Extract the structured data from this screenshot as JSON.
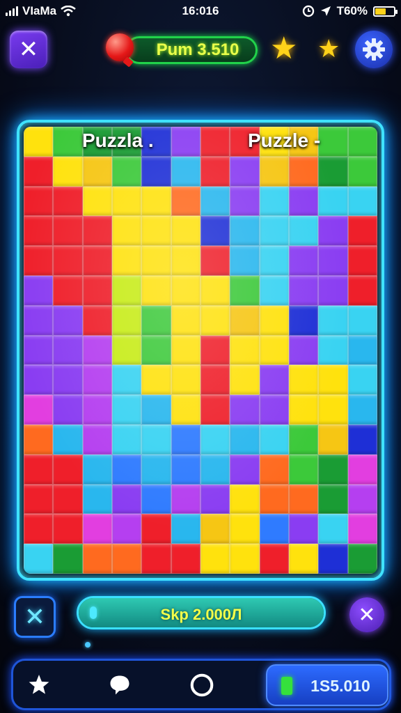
{
  "status_bar": {
    "carrier": "VIaMa",
    "time": "16:016",
    "battery_text": "T60%",
    "battery_level": 0.6
  },
  "header": {
    "score_label": "Pum 3.510",
    "stars_count": 2
  },
  "board": {
    "labels": [
      "Puzzla .",
      "Puzzle -"
    ],
    "columns": 12,
    "rows": 15,
    "palette": {
      "Y": "#ffe20d",
      "y": "#f6c614",
      "L": "#c7ec16",
      "G": "#3cc93a",
      "g": "#1a9c34",
      "C": "#39d3f2",
      "c": "#29b7ee",
      "B": "#2f7bff",
      "N": "#1e2fd6",
      "P": "#8a3df2",
      "V": "#b53ff0",
      "M": "#e23ee0",
      "R": "#ef1f2a",
      "O": "#ff6a1f",
      "K": "#ff3e6a"
    },
    "grid": [
      "YGggNPRRYyGG",
      "RYyGNcRPyOgG",
      "RRYYYOcPCPCC",
      "RRRYYYNcCCPR",
      "RRRYYYRcCPPR",
      "PRRLYYYGCPPR",
      "PPRLGYYyYNCC",
      "PPVLGYRYYPCc",
      "PPVCYYRYPYYC",
      "MPVCcYRPPYYc",
      "OcVCCBCcCGyN",
      "RRcBcBcPOGgM",
      "RRcPBVPYOOgV",
      "RRMVRcyYBPCM",
      "CgOORRYYRYNg"
    ]
  },
  "controls": {
    "progress_label": "Skp 2.000Л",
    "progress_value": 1.0
  },
  "bottom_nav": {
    "coins_value": "1S5.010"
  },
  "colors": {
    "accent_cyan": "#3fe2ff",
    "accent_purple": "#7a3cf0",
    "score_green": "#21d24a"
  }
}
